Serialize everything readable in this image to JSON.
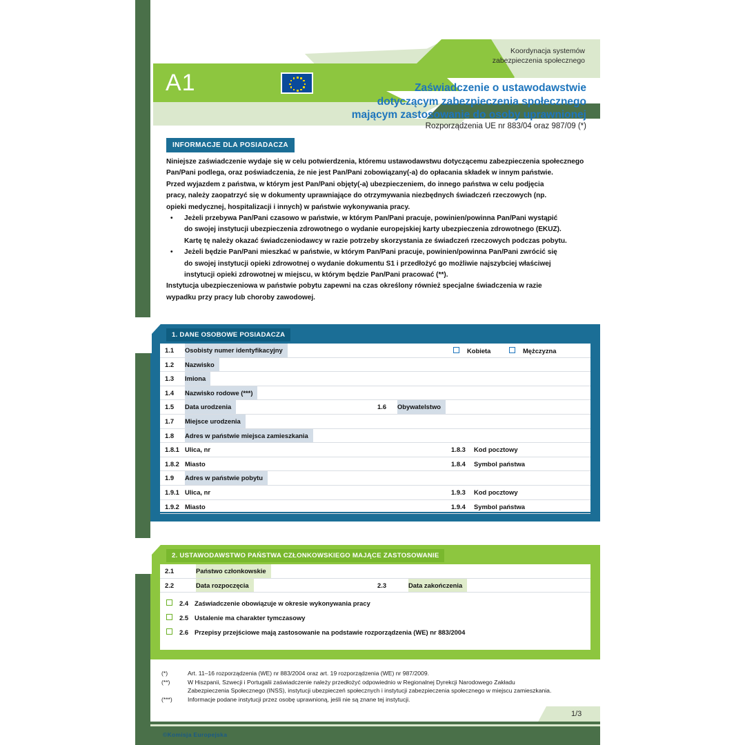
{
  "document": {
    "form_code": "A1",
    "flag": "eu-flag",
    "header_right_line1": "Koordynacja systemów",
    "header_right_line2": "zabezpieczenia społecznego",
    "title_line1": "Zaświadczenie o ustawodawstwie",
    "title_line2": "dotyczącym zabezpieczenia społecznego",
    "title_line3": "mającym zastosowanie do osoby uprawnionej",
    "subtitle": "Rozporządzenia UE nr 883/04 oraz 987/09 (*)",
    "copyright": "©Komisja Europejska",
    "page_number": "1/3"
  },
  "colors": {
    "green_bright": "#8dc63f",
    "green_light": "#dbe8cd",
    "green_dark": "#4a7049",
    "blue_section": "#1b6e96",
    "blue_title": "#1d75bd",
    "tint_blue": "#d3dde7",
    "tint_green": "#dfeccb"
  },
  "info": {
    "badge": "INFORMACJE DLA POSIADACZA",
    "paragraphs": [
      "Niniejsze zaświadczenie wydaje się w celu potwierdzenia, któremu ustawodawstwu dotyczącemu zabezpieczenia społecznego",
      "Pan/Pani podlega, oraz poświadczenia, że nie jest Pan/Pani zobowiązany(-a) do opłacania składek w innym państwie.",
      "Przed wyjazdem z państwa, w którym jest Pan/Pani objęty(-a) ubezpieczeniem, do innego państwa w celu podjęcia",
      "pracy, należy zaopatrzyć się w dokumenty uprawniające do otrzymywania niezbędnych świadczeń rzeczowych (np.",
      "opieki medycznej, hospitalizacji i innych) w państwie wykonywania pracy."
    ],
    "bullet_marker": "•",
    "bullets": [
      [
        "Jeżeli przebywa Pan/Pani czasowo w państwie, w którym Pan/Pani pracuje, powinien/powinna Pan/Pani wystąpić",
        "do swojej instytucji ubezpieczenia zdrowotnego o wydanie europejskiej karty ubezpieczenia zdrowotnego (EKUZ).",
        "Kartę tę należy okazać świadczeniodawcy w razie potrzeby skorzystania ze świadczeń rzeczowych podczas pobytu."
      ],
      [
        "Jeżeli będzie Pan/Pani mieszkać w państwie, w którym Pan/Pani pracuje, powinien/powinna Pan/Pani zwrócić się",
        "do swojej instytucji opieki zdrowotnej o wydanie dokumentu S1 i przedłożyć go możliwie najszybciej właściwej",
        "instytucji opieki zdrowotnej w miejscu, w którym będzie Pan/Pani pracować (**)."
      ]
    ],
    "closing": [
      "Instytucja ubezpieczeniowa w państwie pobytu zapewni na czas określony również specjalne świadczenia w razie",
      "wypadku przy pracy lub choroby zawodowej."
    ]
  },
  "section1": {
    "title": "1. DANE OSOBOWE POSIADACZA",
    "rows": [
      {
        "num": "1.1",
        "label": "Osobisty numer identyfikacyjny"
      },
      {
        "num": "1.2",
        "label": "Nazwisko"
      },
      {
        "num": "1.3",
        "label": "Imiona"
      },
      {
        "num": "1.4",
        "label": "Nazwisko rodowe (***)"
      },
      {
        "num": "1.5",
        "label": "Data urodzenia"
      },
      {
        "num": "1.6",
        "label": "Obywatelstwo"
      },
      {
        "num": "1.7",
        "label": "Miejsce urodzenia"
      },
      {
        "num": "1.8",
        "label": "Adres w państwie miejsca zamieszkania"
      },
      {
        "num": "1.8.1",
        "label": "Ulica, nr"
      },
      {
        "num": "1.8.3",
        "label": "Kod pocztowy"
      },
      {
        "num": "1.8.2",
        "label": "Miasto"
      },
      {
        "num": "1.8.4",
        "label": "Symbol państwa"
      },
      {
        "num": "1.9",
        "label": "Adres w państwie pobytu"
      },
      {
        "num": "1.9.1",
        "label": "Ulica, nr"
      },
      {
        "num": "1.9.3",
        "label": "Kod pocztowy"
      },
      {
        "num": "1.9.2",
        "label": "Miasto"
      },
      {
        "num": "1.9.4",
        "label": "Symbol państwa"
      }
    ],
    "gender": {
      "female": "Kobieta",
      "male": "Mężczyzna",
      "female_checked": false,
      "male_checked": false
    }
  },
  "section2": {
    "title": "2. USTAWODAWSTWO PAŃSTWA CZŁONKOWSKIEGO MAJĄCE ZASTOSOWANIE",
    "rows": [
      {
        "num": "2.1",
        "label": "Państwo członkowskie"
      },
      {
        "num": "2.2",
        "label": "Data rozpoczęcia"
      },
      {
        "num": "2.3",
        "label": "Data zakończenia"
      }
    ],
    "checkboxes": [
      {
        "num": "2.4",
        "label": "Zaświadczenie obowiązuje w okresie wykonywania pracy",
        "checked": false
      },
      {
        "num": "2.5",
        "label": "Ustalenie ma charakter  tymczasowy",
        "checked": false
      },
      {
        "num": "2.6",
        "label": "Przepisy przejściowe mają zastosowanie na podstawie rozporządzenia (WE) nr 883/2004",
        "checked": false
      }
    ]
  },
  "footnotes": [
    {
      "marker": "(*)",
      "lines": [
        "Art. 11–16 rozporządzenia (WE) nr 883/2004 oraz art. 19 rozporządzenia (WE) nr 987/2009."
      ]
    },
    {
      "marker": "(**)",
      "lines": [
        "W Hiszpanii, Szwecji i Portugalii zaświadczenie należy przedłożyć odpowiednio w Regionalnej Dyrekcji Narodowego Zakładu",
        "Zabezpieczenia Społecznego (INSS), instytucji ubezpieczeń społecznych i instytucji zabezpieczenia społecznego w miejscu zamieszkania."
      ]
    },
    {
      "marker": "(***)",
      "lines": [
        "Informacje podane instytucji przez osobę uprawnioną, jeśli nie są znane tej instytucji."
      ]
    }
  ]
}
